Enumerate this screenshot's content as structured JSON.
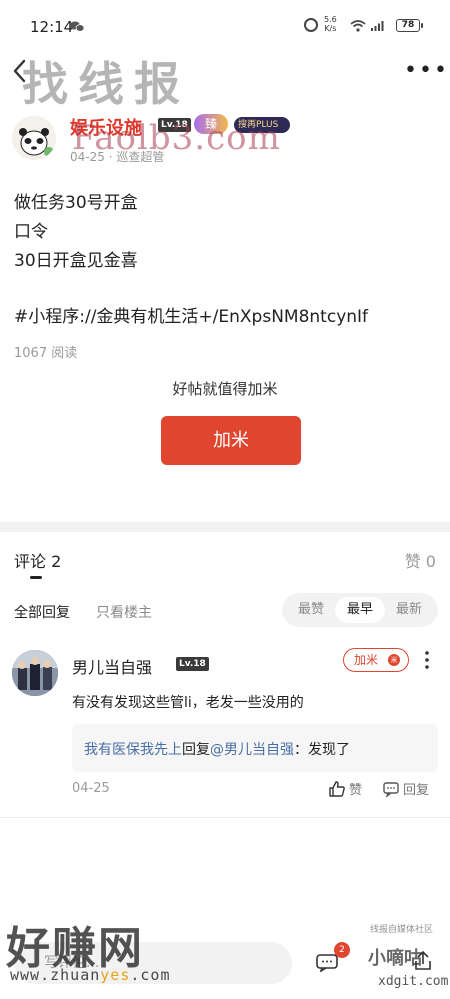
{
  "status_bar": {
    "time": "12:14",
    "net_speed_value": "5.6",
    "net_speed_unit": "K/s",
    "signal_1": "4G",
    "signal_2": "4G",
    "battery": "78"
  },
  "watermarks": {
    "top_title": "找线报",
    "top_url": "Faolb3.com",
    "bottom_title": "好赚网",
    "bottom_url_prefix": "www.zhuan",
    "bottom_url_highlight": "yes",
    "bottom_url_suffix": ".com",
    "right_label": "线报自媒体社区",
    "right_main": "小嘀咕",
    "right_url": "xdgit.com"
  },
  "post": {
    "author": "娱乐设施",
    "author_level": "Lv.18",
    "flame_badge": "臻",
    "plus_badge": "搜再PLUS",
    "date": "04-25",
    "role": "巡查超管",
    "lines": [
      "做任务30号开盒",
      "口令",
      "30日开盒见金喜"
    ],
    "tag_line": "#小程序://金典有机生活+/EnXpsNM8ntcynIf",
    "read_count": "1067 阅读",
    "encourage_text": "好帖就值得加米",
    "add_mi_label": "加米"
  },
  "comments": {
    "title": "评论 2",
    "likes": "赞 0",
    "filter_all": "全部回复",
    "filter_owner": "只看楼主",
    "sort_options": [
      "最赞",
      "最早",
      "最新"
    ],
    "sort_active": "最早",
    "items": [
      {
        "user": "男儿当自强",
        "level": "Lv.18",
        "add_mi_label": "加米",
        "text": "有没有发现这些管li，老发一些没用的",
        "reply_user": "我有医保我先上",
        "reply_mid": "回复",
        "reply_target": "@男儿当自强",
        "reply_text": "：发现了",
        "date": "04-25",
        "like_label": "赞",
        "reply_label": "回复"
      }
    ]
  },
  "bottom_bar": {
    "input_placeholder": "写评论...",
    "message_badge": "2"
  }
}
